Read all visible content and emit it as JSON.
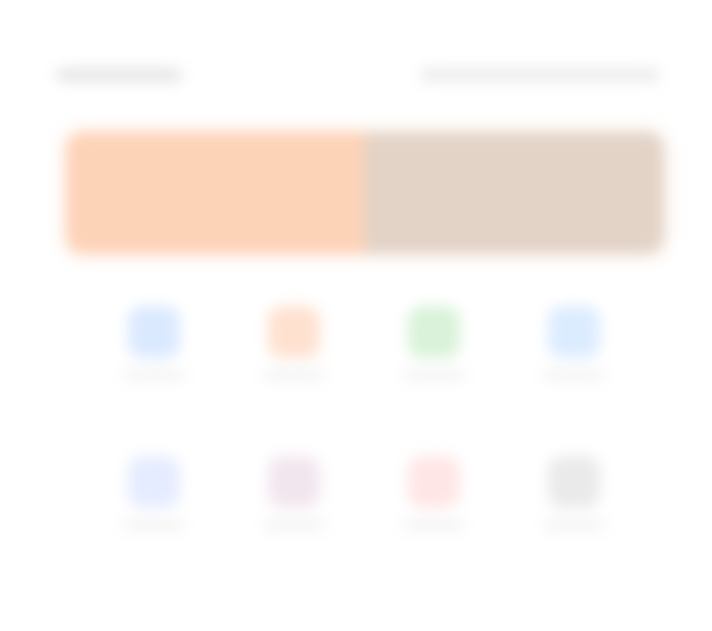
{
  "colors": {
    "banner_left": "#fdd3b8",
    "banner_right": "#e2d3c6",
    "tile_icons": [
      "#dbe9ff",
      "#ffe1d0",
      "#d9f2d9",
      "#dcecff",
      "#e6ecff",
      "#f2e6ee",
      "#ffe6e6",
      "#eaeaea"
    ]
  },
  "tiles": [
    {
      "icon": "app-icon-blue"
    },
    {
      "icon": "app-icon-orange"
    },
    {
      "icon": "app-icon-green"
    },
    {
      "icon": "app-icon-lightblue"
    },
    {
      "icon": "app-icon-indigo"
    },
    {
      "icon": "app-icon-mauve"
    },
    {
      "icon": "app-icon-red"
    },
    {
      "icon": "app-icon-gray"
    }
  ]
}
